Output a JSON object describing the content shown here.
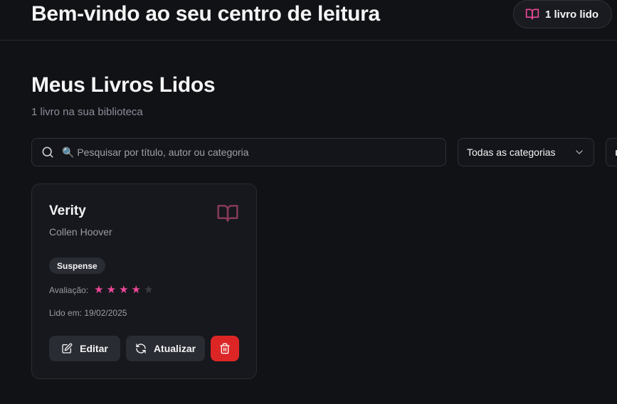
{
  "header": {
    "welcome_title": "Bem-vindo ao seu centro de leitura",
    "books_read_badge": "1 livro lido",
    "badge_icon": "book-open-icon"
  },
  "library": {
    "title": "Meus Livros Lidos",
    "subtitle": "1 livro na sua biblioteca"
  },
  "filters": {
    "search_placeholder": "🔍 Pesquisar por título, autor ou categoria",
    "search_value": "",
    "category_selected": "Todas as categorias"
  },
  "books": [
    {
      "title": "Verity",
      "author": "Collen Hoover",
      "category": "Suspense",
      "rating_label": "Avaliação:",
      "rating": 4,
      "rating_max": 5,
      "read_date": "Lido em: 19/02/2025",
      "edit_label": "Editar",
      "update_label": "Atualizar"
    }
  ],
  "colors": {
    "accent_pink": "#ec4899",
    "star_filled": "#ec4899",
    "star_empty": "#3a3b42",
    "delete_red": "#dc2626",
    "background": "#111216",
    "card_bg": "#17181d"
  }
}
